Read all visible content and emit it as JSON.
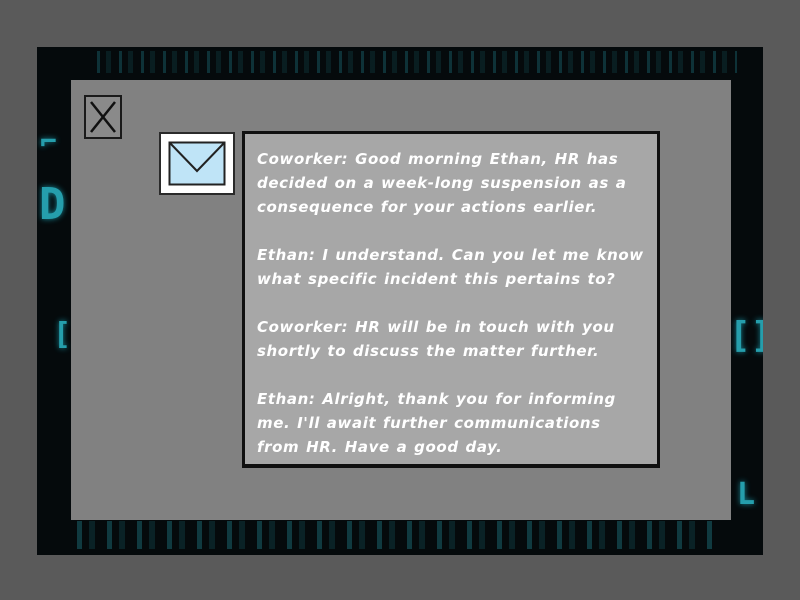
{
  "background": {
    "glyphs": [
      "⌐",
      "D",
      "[",
      "[]",
      "L"
    ]
  },
  "close_button": {
    "icon": "close-icon"
  },
  "mail_icon": {
    "icon": "envelope-icon",
    "color": "#bfe4f7"
  },
  "messages": [
    {
      "text": "Coworker: Good morning Ethan, HR has decided on a week-long suspension as a consequence for your actions earlier."
    },
    {
      "text": "Ethan: I understand. Can you let me know what specific incident this pertains to?"
    },
    {
      "text": "Coworker: HR will be in touch with you shortly to discuss the matter further."
    },
    {
      "text": "Ethan: Alright, thank you for informing me. I'll await further communications from HR. Have a good day."
    }
  ],
  "colors": {
    "glyph_accent": "#2bb8c8",
    "panel": "#818181",
    "message_box": "#a7a7a7",
    "text": "#ffffff"
  }
}
